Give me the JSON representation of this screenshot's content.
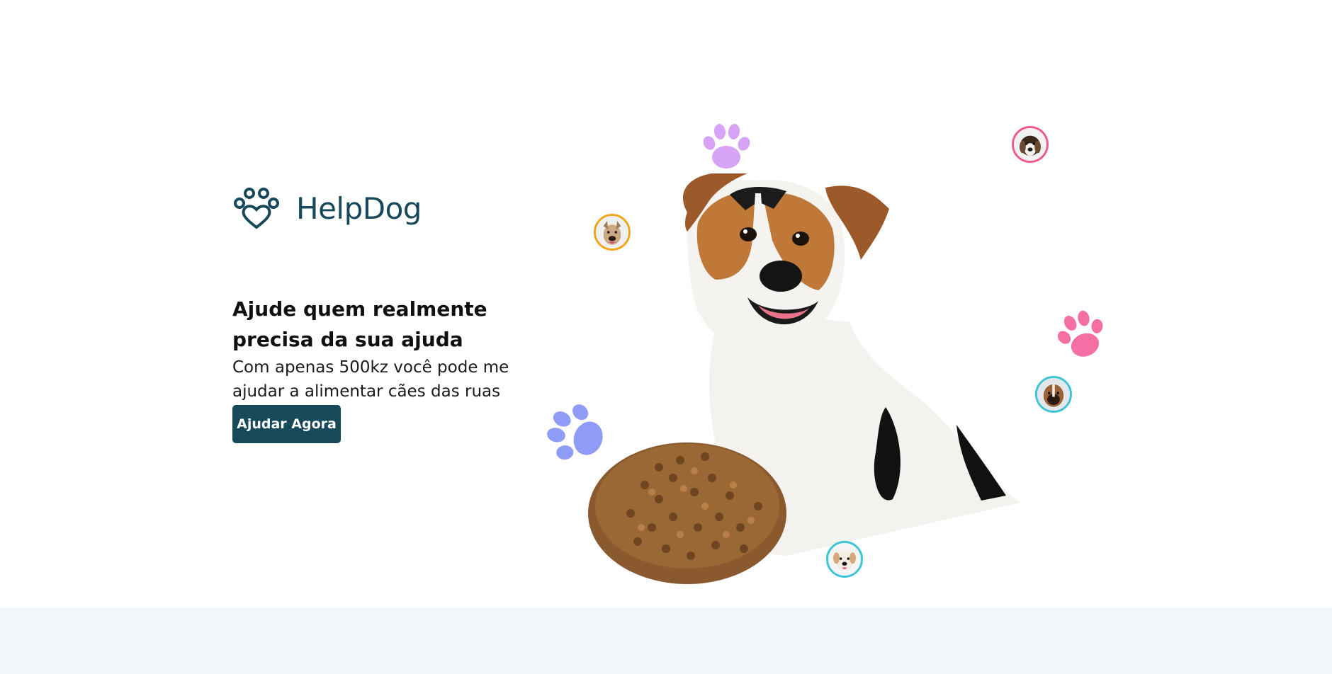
{
  "brand": {
    "name": "HelpDog",
    "color": "#17495a"
  },
  "hero": {
    "headline": "Ajude quem realmente precisa da sua ajuda",
    "subtext": "Com apenas 500kz você pode me ajudar a alimentar cães das ruas",
    "cta_label": "Ajudar Agora"
  },
  "colors": {
    "accent": "#17495a",
    "paw_purple": "#d6a3f5",
    "paw_pink": "#f36fa4",
    "paw_blue": "#8f9cf7",
    "bottom_band": "#f1f6fa"
  },
  "illustration": {
    "main_image": "jack-russell-terrier-with-kibble",
    "avatars": [
      "dog-avatar-pitbull",
      "dog-avatar-beagle",
      "dog-avatar-boxer",
      "dog-avatar-white-dog"
    ],
    "paws": [
      "paw-icon-purple",
      "paw-icon-pink",
      "paw-icon-blue"
    ]
  }
}
